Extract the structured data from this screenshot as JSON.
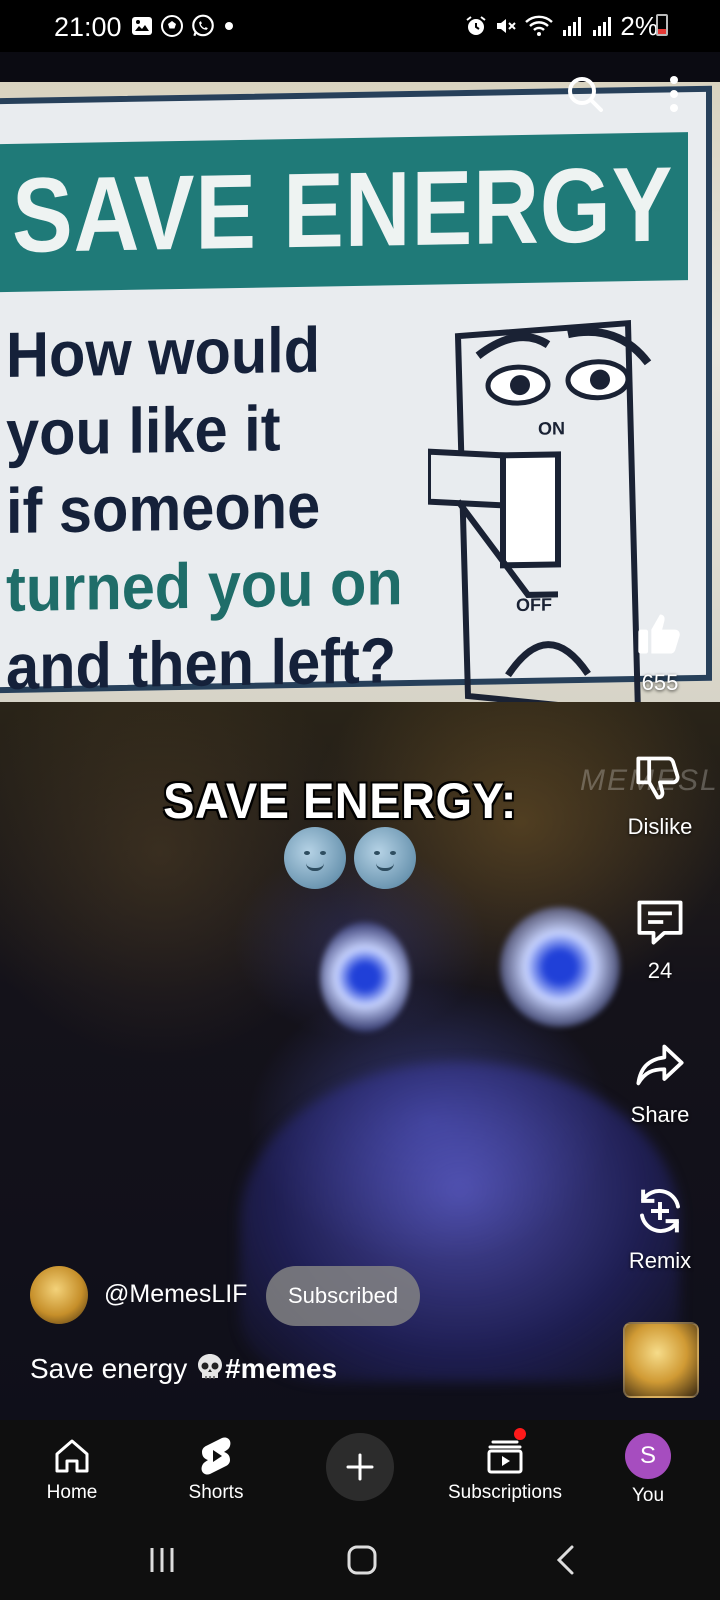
{
  "status_bar": {
    "time": "21:00",
    "battery": "2%",
    "battery_level": 0.02,
    "left_icons": [
      "gallery-icon",
      "soccer-ball-icon",
      "whatsapp-icon",
      "dot-icon"
    ],
    "right_icons": [
      "alarm-icon",
      "mute-icon",
      "wifi-icon",
      "signal-icon",
      "signal-icon"
    ]
  },
  "video": {
    "sign_header": "SAVE ENERGY",
    "sign_lines": [
      "How would",
      "you like it",
      "if someone",
      "turned you on",
      "and then left?"
    ],
    "switch_on": "ON",
    "switch_off": "OFF",
    "overlay_caption": "SAVE ENERGY:",
    "watermark": "MEMESLI"
  },
  "top_actions": {
    "search_icon": "search-icon",
    "more_icon": "more-vertical-icon"
  },
  "actions": {
    "like_count": "655",
    "dislike_label": "Dislike",
    "comment_count": "24",
    "share_label": "Share",
    "remix_label": "Remix"
  },
  "channel": {
    "handle": "@MemesLIF",
    "subscribe_label": "Subscribed"
  },
  "title": {
    "text": "Save energy ",
    "hashtag": "#memes"
  },
  "nav": {
    "home": "Home",
    "shorts": "Shorts",
    "subscriptions": "Subscriptions",
    "you": "You",
    "you_initial": "S"
  },
  "colors": {
    "nav_bg": "#0f0f0f",
    "accent_red": "#ff1a1a",
    "you_avatar": "#a64dbf",
    "subscribed_bg": "#828282"
  }
}
